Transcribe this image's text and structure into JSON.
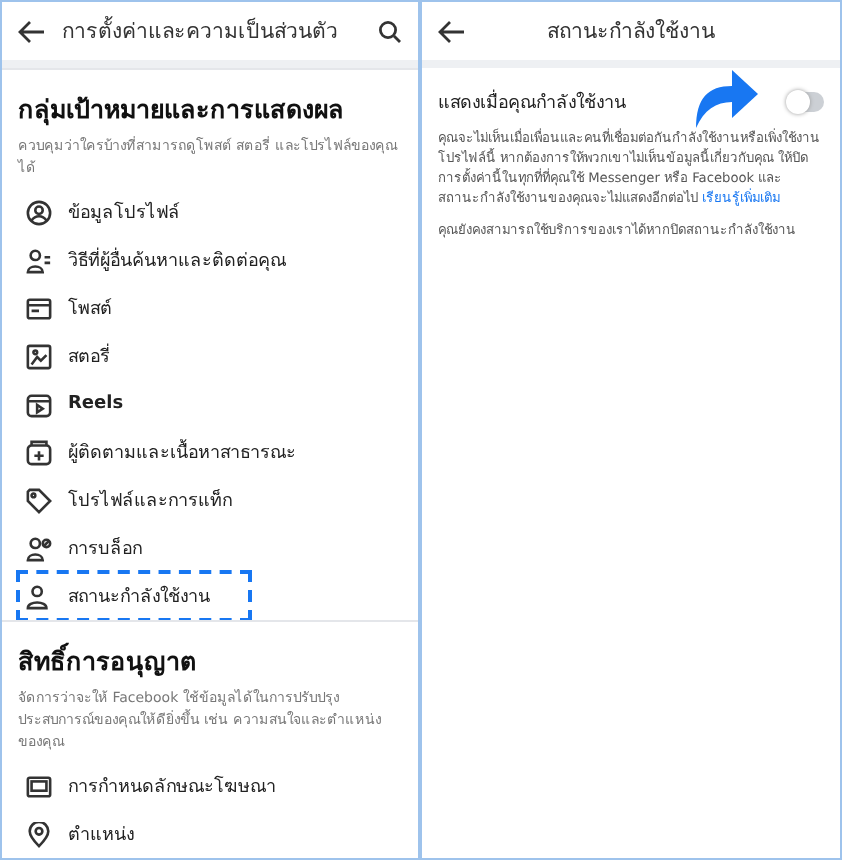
{
  "privacy_panel": {
    "title": "การตั้งค่าและความเป็นส่วนตัว",
    "sections": [
      {
        "heading": "กลุ่มเป้าหมายและการแสดงผล",
        "description": "ควบคุมว่าใครบ้างที่สามารถดูโพสต์ สตอรี่ และโปรไฟล์ของคุณได้",
        "items": [
          {
            "label": "ข้อมูลโปรไฟล์",
            "highlighted": false
          },
          {
            "label": "วิธีที่ผู้อื่นค้นหาและติดต่อคุณ",
            "highlighted": false
          },
          {
            "label": "โพสต์",
            "highlighted": false
          },
          {
            "label": "สตอรี่",
            "highlighted": false
          },
          {
            "label": "Reels",
            "highlighted": false
          },
          {
            "label": "ผู้ติดตามและเนื้อหาสาธารณะ",
            "highlighted": false
          },
          {
            "label": "โปรไฟล์และการแท็ก",
            "highlighted": false
          },
          {
            "label": "การบล็อก",
            "highlighted": false
          },
          {
            "label": "สถานะกำลังใช้งาน",
            "highlighted": true
          }
        ]
      },
      {
        "heading": "สิทธิ์การอนุญาต",
        "description": "จัดการว่าจะให้ Facebook ใช้ข้อมูลได้ในการปรับปรุงประสบการณ์ของคุณให้ดียิ่งขึ้น เช่น ความสนใจและตำแหน่งของคุณ",
        "items": [
          {
            "label": "การกำหนดลักษณะโฆษณา",
            "highlighted": false
          },
          {
            "label": "ตำแหน่ง",
            "highlighted": false
          }
        ]
      }
    ]
  },
  "status_panel": {
    "title": "สถานะกำลังใช้งาน",
    "setting_label": "แสดงเมื่อคุณกำลังใช้งาน",
    "on": false,
    "explanation": "คุณจะไม่เห็นเมื่อเพื่อนและคนที่เชื่อมต่อกันกำลังใช้งานหรือเพิ่งใช้งานโปรไฟล์นี้ หากต้องการให้พวกเขาไม่เห็นข้อมูลนี้เกี่ยวกับคุณ ให้ปิดการตั้งค่านี้ในทุกที่ที่คุณใช้ Messenger หรือ Facebook และสถานะกำลังใช้งานของคุณจะไม่แสดงอีกต่อไป",
    "learn_more": "เรียนรู้เพิ่มเติม",
    "note": "คุณยังคงสามารถใช้บริการของเราได้หากปิดสถานะกำลังใช้งาน"
  }
}
